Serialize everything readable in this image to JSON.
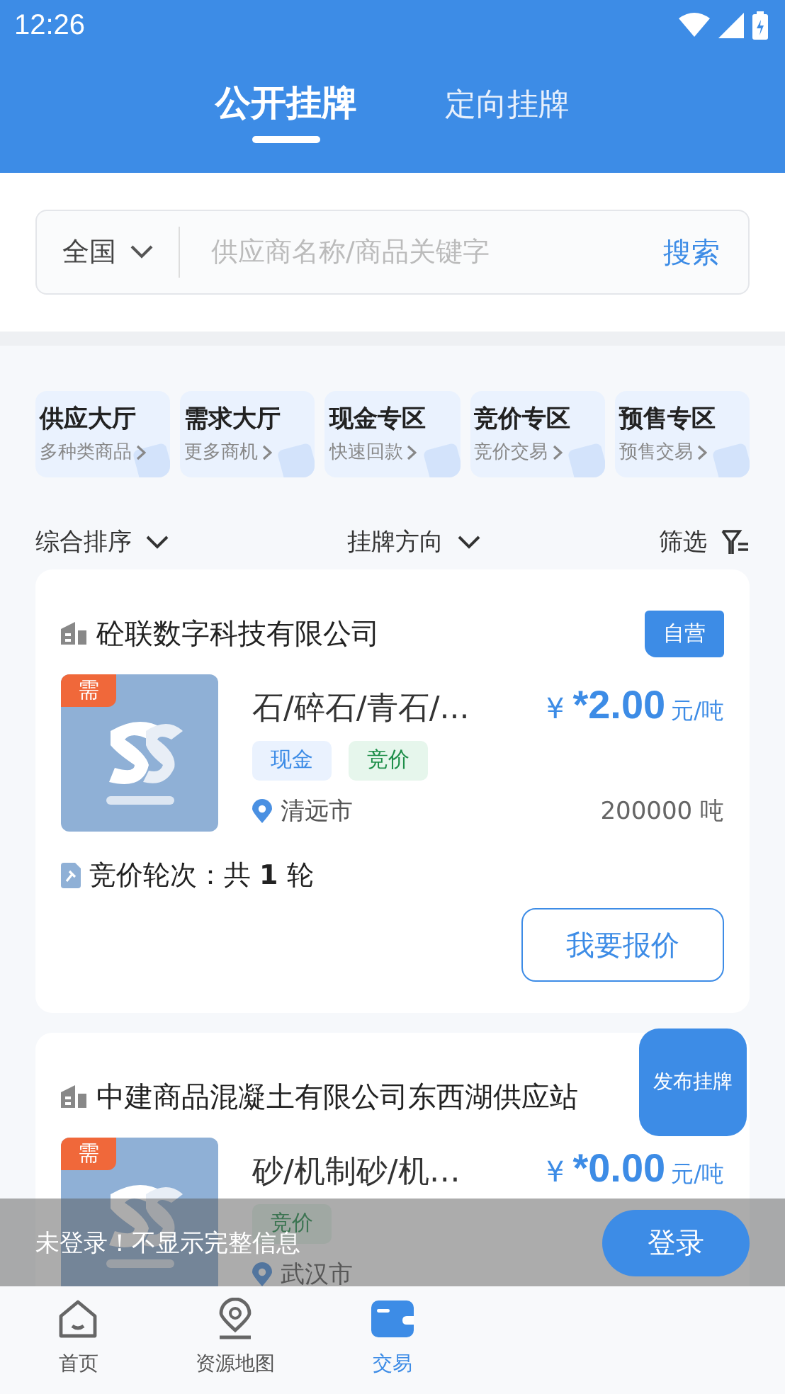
{
  "status_bar": {
    "time": "12:26"
  },
  "header_tabs": [
    {
      "label": "公开挂牌",
      "selected": true
    },
    {
      "label": "定向挂牌",
      "selected": false
    }
  ],
  "search": {
    "region": "全国",
    "placeholder": "供应商名称/商品关键字",
    "button": "搜索"
  },
  "categories": [
    {
      "title": "供应大厅",
      "subtitle": "多种类商品"
    },
    {
      "title": "需求大厅",
      "subtitle": "更多商机"
    },
    {
      "title": "现金专区",
      "subtitle": "快速回款"
    },
    {
      "title": "竞价专区",
      "subtitle": "竞价交易"
    },
    {
      "title": "预售专区",
      "subtitle": "预售交易"
    }
  ],
  "sort_bar": [
    {
      "label": "综合排序",
      "kind": "dropdown"
    },
    {
      "label": "挂牌方向",
      "kind": "dropdown"
    },
    {
      "label": "筛选",
      "kind": "filter"
    }
  ],
  "listings": [
    {
      "company": "砼联数字科技有限公司",
      "badge": "自营",
      "corner_tag": "需",
      "product": "石/碎石/青石/...",
      "currency": "¥",
      "price": "*2.00",
      "unit": "元/吨",
      "tags": [
        {
          "label": "现金",
          "kind": "cash"
        },
        {
          "label": "竞价",
          "kind": "bid"
        }
      ],
      "location": "清远市",
      "quantity": "200000 吨",
      "bid_rounds": "竞价轮次：共 **1** 轮",
      "action": "我要报价"
    },
    {
      "company": "中建商品混凝土有限公司东西湖供应站",
      "corner_tag": "需",
      "product": "砂/机制砂/机…",
      "currency": "¥",
      "price": "*0.00",
      "unit": "元/吨",
      "tags": [
        {
          "label": "竞价",
          "kind": "bid"
        }
      ],
      "location": "武汉市"
    }
  ],
  "publish_button": "发布挂牌",
  "login_banner": {
    "message": "未登录！不显示完整信息",
    "button": "登录"
  },
  "bottom_nav": [
    {
      "label": "首页",
      "selected": false
    },
    {
      "label": "资源地图",
      "selected": false
    },
    {
      "label": "交易",
      "selected": true
    }
  ]
}
